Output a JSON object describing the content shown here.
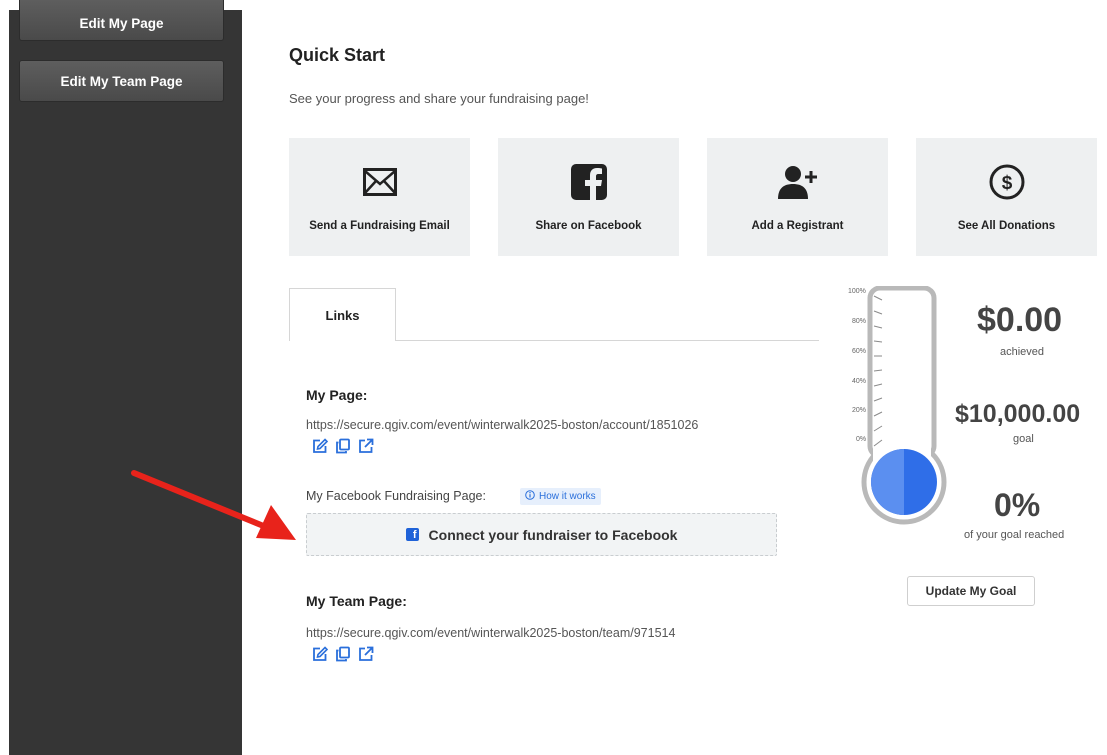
{
  "sidebar": {
    "edit_page": "Edit My Page",
    "edit_team_page": "Edit My Team Page"
  },
  "quick_start": {
    "title": "Quick Start",
    "subtitle": "See your progress and share your fundraising page!",
    "cards": [
      {
        "label": "Send a Fundraising Email",
        "icon": "envelope-icon"
      },
      {
        "label": "Share on Facebook",
        "icon": "facebook-icon"
      },
      {
        "label": "Add a Registrant",
        "icon": "add-user-icon"
      },
      {
        "label": "See All Donations",
        "icon": "dollar-circle-icon"
      }
    ]
  },
  "tabs": {
    "links": "Links"
  },
  "links": {
    "my_page_label": "My Page:",
    "my_page_url": "https://secure.qgiv.com/event/winterwalk2025-boston/account/1851026",
    "fb_label": "My Facebook Fundraising Page:",
    "how_it_works": "How it works",
    "connect_fb": "Connect your fundraiser to Facebook",
    "team_page_label": "My Team Page:",
    "team_page_url": "https://secure.qgiv.com/event/winterwalk2025-boston/team/971514"
  },
  "thermometer": {
    "ticks": [
      "100%",
      "80%",
      "60%",
      "40%",
      "20%",
      "0%"
    ],
    "progress": 0
  },
  "stats": {
    "achieved_value": "$0.00",
    "achieved_label": "achieved",
    "goal_value": "$10,000.00",
    "goal_label": "goal",
    "percent_value": "0%",
    "percent_label": "of your goal reached",
    "update_goal": "Update My Goal"
  },
  "colors": {
    "sidebar": "#353535",
    "accent_blue": "#1f62d8",
    "arrow": "#e8231b"
  }
}
